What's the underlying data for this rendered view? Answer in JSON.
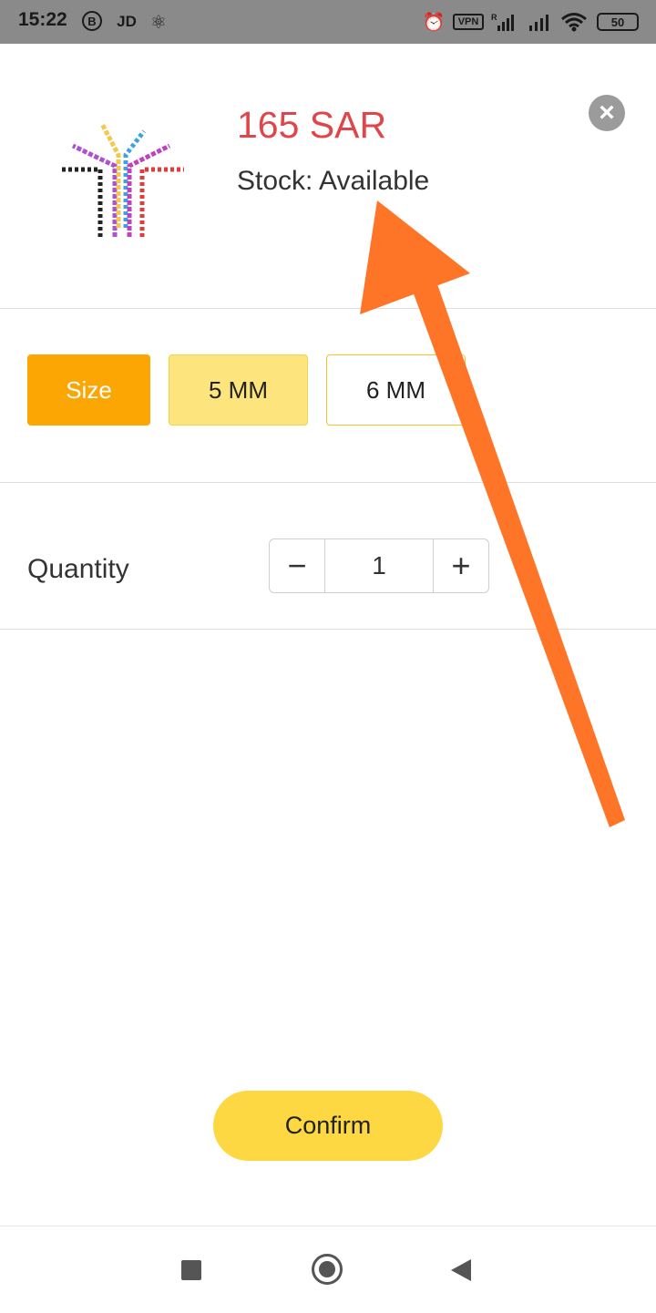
{
  "status_bar": {
    "time": "15:22",
    "b_badge": "B",
    "jd_label": "JD",
    "vpn_label": "VPN",
    "signal_roaming": "R",
    "battery_level": "50"
  },
  "product": {
    "price": "165 SAR",
    "stock": "Stock: Available"
  },
  "size_options": {
    "label": "Size",
    "options": [
      "5 MM",
      "6 MM"
    ],
    "selected": "5 MM"
  },
  "quantity": {
    "label": "Quantity",
    "value": "1",
    "minus_symbol": "−",
    "plus_symbol": "+"
  },
  "confirm_label": "Confirm",
  "colors": {
    "price": "#e0454a",
    "size_label_bg": "#fca604",
    "selected_option_bg": "#fde47c",
    "confirm_bg": "#fdd843",
    "annotation_arrow": "#ff7527"
  },
  "icons": {
    "close": "close-circle-icon",
    "alarm": "alarm-icon",
    "wifi": "wifi-icon",
    "nav_recent": "square-icon",
    "nav_home": "circle-icon",
    "nav_back": "triangle-back-icon"
  }
}
